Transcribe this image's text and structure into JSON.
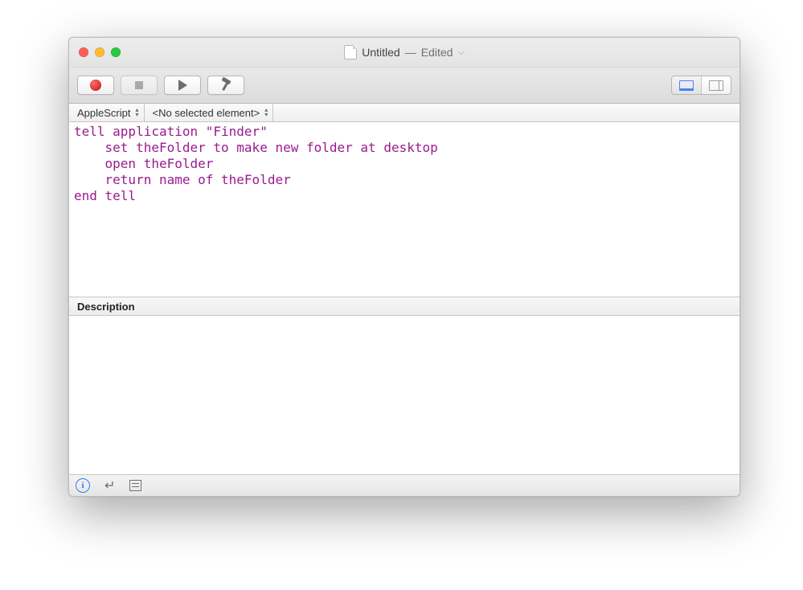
{
  "title": {
    "doc_name": "Untitled",
    "state": "Edited"
  },
  "nav": {
    "language": "AppleScript",
    "element": "<No selected element>"
  },
  "code": "tell application \"Finder\"\n    set theFolder to make new folder at desktop\n    open theFolder\n    return name of theFolder\nend tell",
  "panels": {
    "description_label": "Description"
  }
}
